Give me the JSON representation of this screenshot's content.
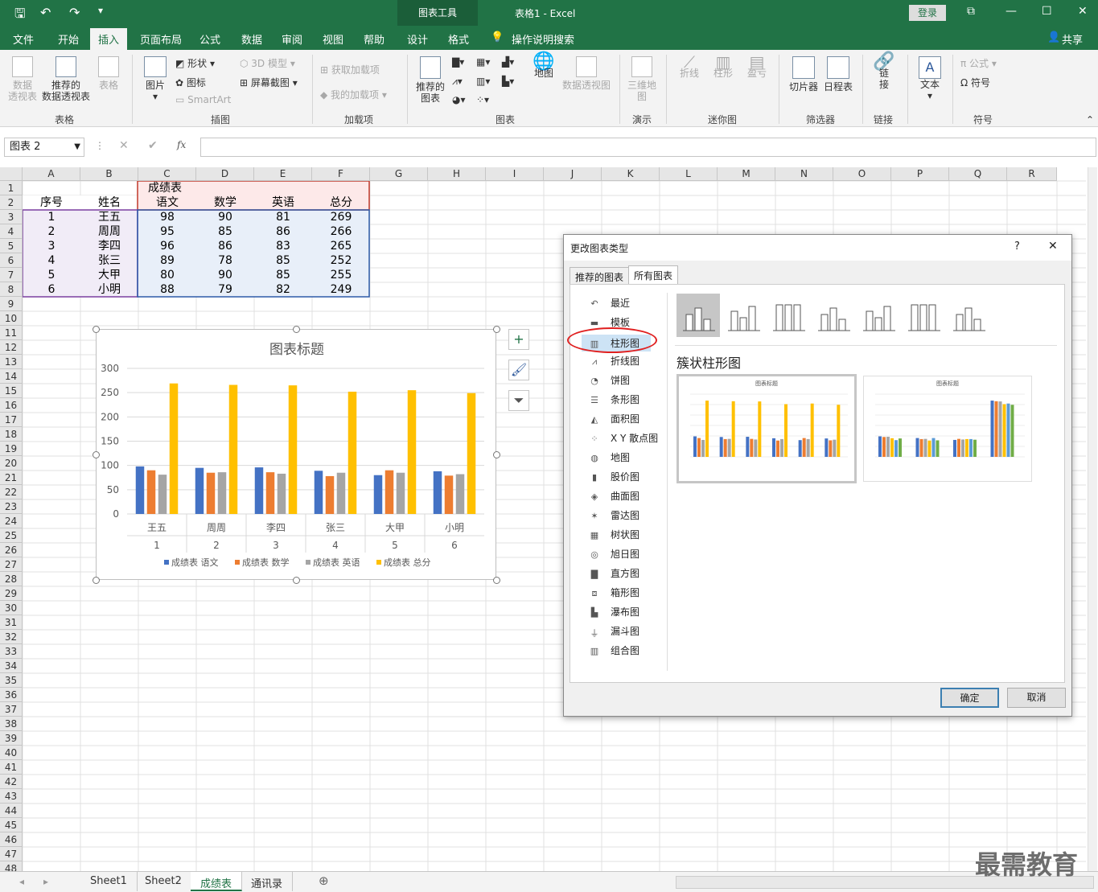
{
  "titlebar": {
    "context_tab": "图表工具",
    "window_title": "表格1  -  Excel",
    "login": "登录",
    "undo_icon": "undo-icon",
    "redo_icon": "redo-icon",
    "save_icon": "save-icon"
  },
  "menu": [
    "文件",
    "开始",
    "插入",
    "页面布局",
    "公式",
    "数据",
    "审阅",
    "视图",
    "帮助",
    "设计",
    "格式",
    "操作说明搜索",
    "共享"
  ],
  "ribbon": {
    "tables": {
      "pivot": "数据\n透视表",
      "recommended_pivot": "推荐的\n数据透视表",
      "table": "表格",
      "group": "表格"
    },
    "illustrations": {
      "pictures": "图片",
      "shapes": "形状",
      "icons": "图标",
      "smartart": "SmartArt",
      "models3d": "3D 模型",
      "screenshot": "屏幕截图",
      "group": "插图"
    },
    "addins": {
      "get": "获取加载项",
      "my": "我的加载项",
      "group": "加载项"
    },
    "charts": {
      "recommended": "推荐的\n图表",
      "maps": "地图",
      "pivot_chart": "数据透视图",
      "group": "图表"
    },
    "tours": {
      "map3d": "三维地\n图",
      "group": "演示"
    },
    "sparklines": {
      "line": "折线",
      "column": "柱形",
      "winloss": "盈亏",
      "group": "迷你图"
    },
    "filters": {
      "slicer": "切片器",
      "timeline": "日程表",
      "group": "筛选器"
    },
    "links": {
      "link": "链\n接",
      "group": "链接"
    },
    "text": {
      "text": "文本"
    },
    "symbols": {
      "equation": "公式",
      "symbol": "符号",
      "group": "符号"
    }
  },
  "formula_bar": {
    "name_box": "图表 2",
    "fx": "fx"
  },
  "columns": [
    "A",
    "B",
    "C",
    "D",
    "E",
    "F",
    "G",
    "H",
    "I",
    "J",
    "K",
    "L",
    "M",
    "N",
    "O",
    "P",
    "Q",
    "R"
  ],
  "rows": [
    "1",
    "2",
    "3",
    "4",
    "5",
    "6",
    "7",
    "8",
    "9",
    "10",
    "11",
    "12",
    "13",
    "14",
    "15",
    "16",
    "17",
    "18",
    "19",
    "20",
    "21",
    "22",
    "23",
    "24",
    "25",
    "26",
    "27",
    "28",
    "29",
    "30",
    "31",
    "32",
    "33",
    "34",
    "35",
    "36",
    "37",
    "38",
    "39",
    "40",
    "41",
    "42",
    "43",
    "44",
    "45",
    "46",
    "47",
    "48"
  ],
  "sheet": {
    "title": "成绩表",
    "headers": [
      "序号",
      "姓名",
      "语文",
      "数学",
      "英语",
      "总分"
    ],
    "data": [
      [
        "1",
        "王五",
        "98",
        "90",
        "81",
        "269"
      ],
      [
        "2",
        "周周",
        "95",
        "85",
        "86",
        "266"
      ],
      [
        "3",
        "李四",
        "96",
        "86",
        "83",
        "265"
      ],
      [
        "4",
        "张三",
        "89",
        "78",
        "85",
        "252"
      ],
      [
        "5",
        "大甲",
        "80",
        "90",
        "85",
        "255"
      ],
      [
        "6",
        "小明",
        "88",
        "79",
        "82",
        "249"
      ]
    ]
  },
  "chart_data": {
    "type": "bar",
    "title": "图表标题",
    "categories": [
      "王五",
      "周周",
      "李四",
      "张三",
      "大甲",
      "小明"
    ],
    "category_index": [
      "1",
      "2",
      "3",
      "4",
      "5",
      "6"
    ],
    "yticks": [
      "0",
      "50",
      "100",
      "150",
      "200",
      "250",
      "300"
    ],
    "ylim": [
      0,
      300
    ],
    "legend_position": "bottom",
    "series": [
      {
        "name": "成绩表 语文",
        "color": "#4472c4",
        "values": [
          98,
          95,
          96,
          89,
          80,
          88
        ]
      },
      {
        "name": "成绩表 数学",
        "color": "#ed7d31",
        "values": [
          90,
          85,
          86,
          78,
          90,
          79
        ]
      },
      {
        "name": "成绩表 英语",
        "color": "#a5a5a5",
        "values": [
          81,
          86,
          83,
          85,
          85,
          82
        ]
      },
      {
        "name": "成绩表 总分",
        "color": "#ffc000",
        "values": [
          269,
          266,
          265,
          252,
          255,
          249
        ]
      }
    ]
  },
  "chart_buttons": [
    "plus-icon",
    "brush-icon",
    "filter-icon"
  ],
  "dialog": {
    "title": "更改图表类型",
    "help": "?",
    "close": "✕",
    "tabs": [
      "推荐的图表",
      "所有图表"
    ],
    "types": [
      "最近",
      "模板",
      "柱形图",
      "折线图",
      "饼图",
      "条形图",
      "面积图",
      "X Y 散点图",
      "地图",
      "股价图",
      "曲面图",
      "雷达图",
      "树状图",
      "旭日图",
      "直方图",
      "箱形图",
      "瀑布图",
      "漏斗图",
      "组合图"
    ],
    "subtype_label": "簇状柱形图",
    "preview_title": "图表标题",
    "ok": "确定",
    "cancel": "取消"
  },
  "sheets": [
    "Sheet1",
    "Sheet2",
    "成绩表",
    "通讯录"
  ],
  "watermark": "最需教育"
}
